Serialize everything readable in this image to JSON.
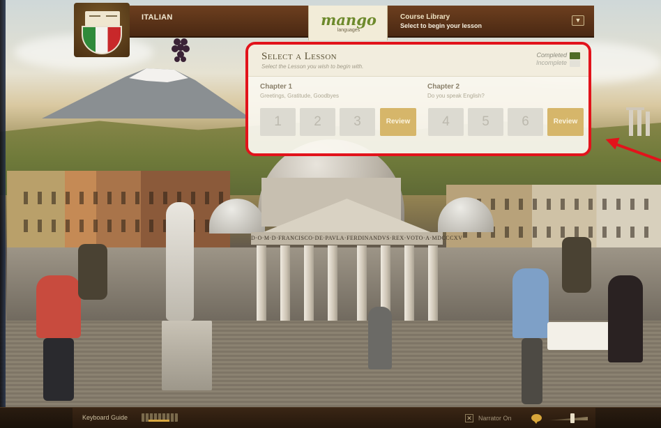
{
  "header": {
    "language": "ITALIAN",
    "logo_text": "mango",
    "logo_subtext": "languages",
    "library_title": "Course Library",
    "library_subtitle": "Select to begin your lesson",
    "dropdown_icon": "chevron-down-icon"
  },
  "panel": {
    "title": "Select a Lesson",
    "subtitle": "Select the Lesson you wish to begin with.",
    "legend_completed": "Completed",
    "legend_incomplete": "Incomplete",
    "colors": {
      "completed": "#4f6b25",
      "incomplete": "#e3e1d8",
      "review": "#d6b66a",
      "highlight": "#e2131b"
    },
    "chapters": [
      {
        "title": "Chapter 1",
        "subtitle": "Greetings, Gratitude, Goodbyes",
        "lessons": [
          "1",
          "2",
          "3"
        ],
        "review_label": "Review"
      },
      {
        "title": "Chapter 2",
        "subtitle": "Do you speak English?",
        "lessons": [
          "4",
          "5",
          "6"
        ],
        "review_label": "Review"
      }
    ]
  },
  "scene": {
    "inscription": "D·O·M·D·FRANCISCO·DE·PAVLA·FERDINANDVS·REX·VOTO·A·MDCCCXV"
  },
  "footer": {
    "keyboard_guide": "Keyboard Guide",
    "narrator_label": "Narrator On",
    "narrator_checkbox": "✕"
  }
}
